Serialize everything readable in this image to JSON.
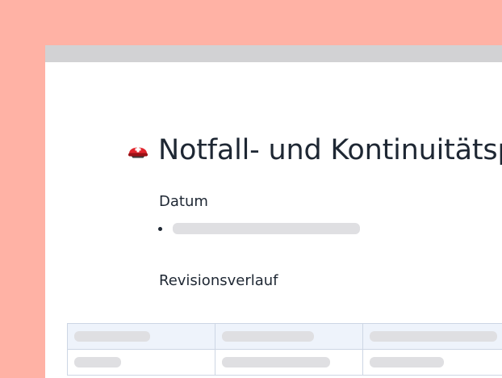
{
  "document": {
    "title": "Notfall- und Kontinuitätsplan",
    "title_icon": "rescue-helmet-icon",
    "sections": {
      "date_heading": "Datum",
      "revision_heading": "Revisionsverlauf"
    }
  },
  "colors": {
    "background": "#ffb2a5",
    "topbar": "#d2d2d4",
    "text": "#1e2733",
    "placeholder": "#dfdfe2",
    "table_header": "#eef3fb",
    "table_border": "#cdd6e4"
  }
}
